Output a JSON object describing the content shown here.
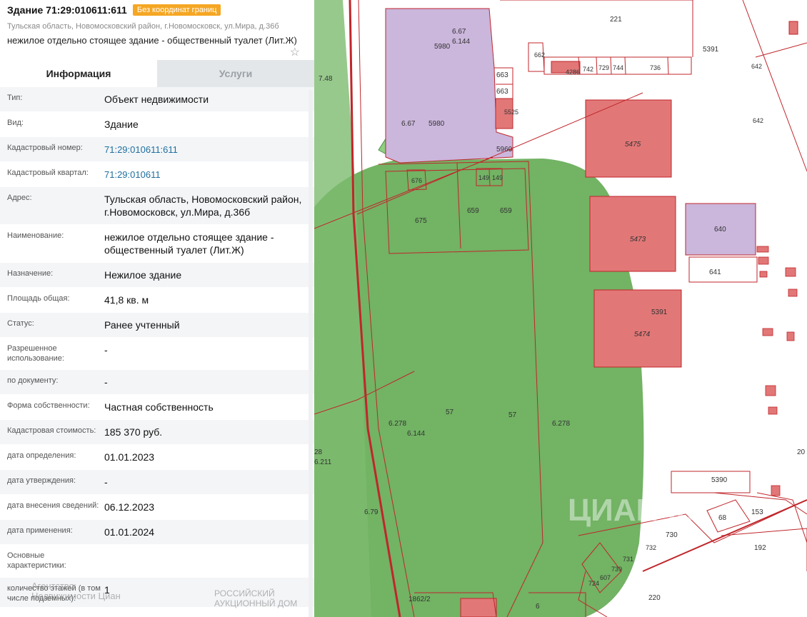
{
  "header": {
    "title": "Здание 71:29:010611:611",
    "badge": "Без координат границ",
    "address": "Тульская область, Новомосковский район, г.Новомосковск, ул.Мира, д.36б",
    "name": "нежилое отдельно стоящее здание - общественный туалет (Лит.Ж)",
    "star_icon": "star-outline-icon"
  },
  "tabs": [
    {
      "label": "Информация",
      "active": true
    },
    {
      "label": "Услуги",
      "active": false
    }
  ],
  "rows": [
    {
      "label": "Тип:",
      "value": "Объект недвижимости"
    },
    {
      "label": "Вид:",
      "value": "Здание"
    },
    {
      "label": "Кадастровый номер:",
      "value": "71:29:010611:611",
      "link": true
    },
    {
      "label": "Кадастровый квартал:",
      "value": "71:29:010611",
      "link": true
    },
    {
      "label": "Адрес:",
      "value": "Тульская область, Новомосковский район, г.Новомосковск, ул.Мира, д.36б"
    },
    {
      "label": "Наименование:",
      "value": "нежилое отдельно стоящее здание - общественный туалет (Лит.Ж)"
    },
    {
      "label": "Назначение:",
      "value": "Нежилое здание"
    },
    {
      "label": "Площадь общая:",
      "value": "41,8 кв. м"
    },
    {
      "label": "Статус:",
      "value": "Ранее учтенный"
    },
    {
      "label": "Разрешенное использование:",
      "value": "-"
    },
    {
      "label": "по документу:",
      "value": "-"
    },
    {
      "label": "Форма собственности:",
      "value": "Частная собственность"
    },
    {
      "label": "Кадастровая стоимость:",
      "value": "185 370 руб."
    },
    {
      "label": "дата определения:",
      "value": "01.01.2023"
    },
    {
      "label": "дата утверждения:",
      "value": "-"
    },
    {
      "label": "дата внесения сведений:",
      "value": "06.12.2023"
    },
    {
      "label": "дата применения:",
      "value": "01.01.2024"
    },
    {
      "label": "Основные характеристики:",
      "value": ""
    },
    {
      "label": "количество этажей (в том числе подземных):",
      "value": "1"
    }
  ],
  "map_labels": [
    "5980",
    "6.67",
    "6.144",
    "6.67",
    "5980",
    "5960",
    "663",
    "663",
    "5525",
    "676",
    "149",
    "149",
    "675",
    "659",
    "659",
    "7.48",
    "221",
    "662",
    "4286",
    "742",
    "729",
    "744",
    "736",
    "5391",
    "642",
    "642",
    "5475",
    "5473",
    "5474",
    "5391",
    "640",
    "641",
    "57",
    "57",
    "6.278",
    "6.144",
    "6.278",
    "28",
    "6.211",
    "6.79",
    "5390",
    "68",
    "153",
    "192",
    "730",
    "732",
    "731",
    "739",
    "607",
    "724",
    "220",
    "1862/2",
    "6",
    "20"
  ],
  "watermarks": {
    "agency": "Агентство Недвижимости Циан",
    "auction": "РОССИЙСКИЙ АУКЦИОННЫЙ ДОМ",
    "cian_id": "ЦИАН ID"
  },
  "colors": {
    "badge": "#f5a623",
    "park_green": "#6aaf5c",
    "building_red": "#e27777",
    "parcel_purple": "#cbb6dc",
    "boundary": "#c0262b",
    "link": "#1f6f9e"
  }
}
